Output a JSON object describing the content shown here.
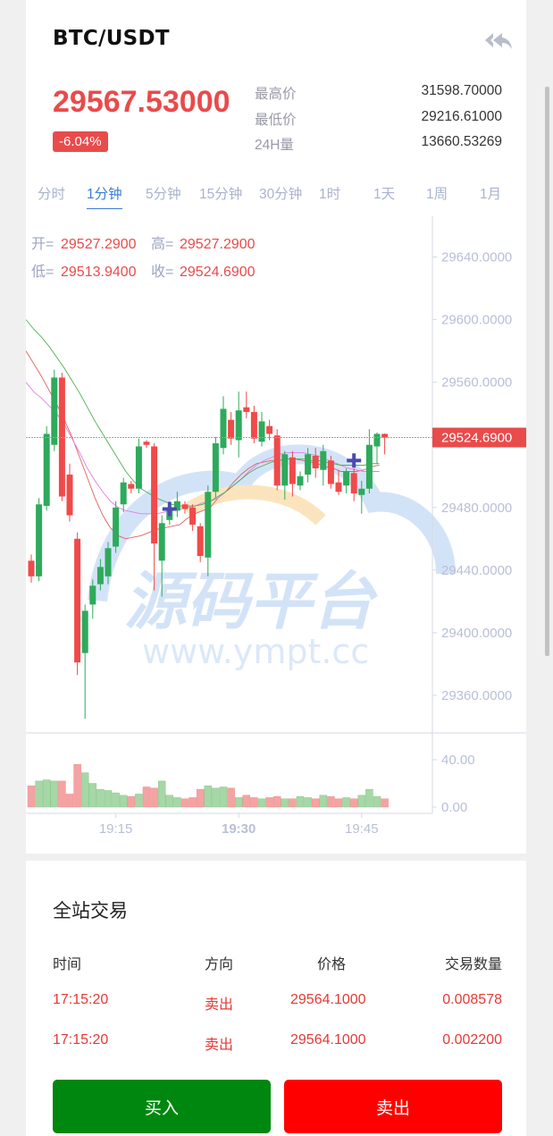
{
  "header": {
    "pair": "BTC/USDT",
    "back_icon": "double-back-arrow-icon"
  },
  "ticker": {
    "price": "29567.53000",
    "change": "-6.04%",
    "stats": [
      {
        "label": "最高价",
        "value": "31598.70000"
      },
      {
        "label": "最低价",
        "value": "29216.61000"
      },
      {
        "label": "24H量",
        "value": "13660.53269"
      }
    ]
  },
  "tabs": [
    {
      "label": "分时",
      "active": false
    },
    {
      "label": "1分钟",
      "active": true
    },
    {
      "label": "5分钟",
      "active": false
    },
    {
      "label": "15分钟",
      "active": false
    },
    {
      "label": "30分钟",
      "active": false
    },
    {
      "label": "1时",
      "active": false
    },
    {
      "label": "1天",
      "active": false
    },
    {
      "label": "1周",
      "active": false
    },
    {
      "label": "1月",
      "active": false
    }
  ],
  "watermark": {
    "cn": "源码平台",
    "url": "www.ympt.cc"
  },
  "chart_data": {
    "type": "candlestick",
    "ohlc_legend": {
      "open_label": "开=",
      "open": "29527.2900",
      "high_label": "高=",
      "high": "29527.2900",
      "low_label": "低=",
      "low": "29513.9400",
      "close_label": "收=",
      "close": "29524.6900"
    },
    "y_ticks": [
      "29640.0000",
      "29600.0000",
      "29560.0000",
      "29480.0000",
      "29440.0000",
      "29400.0000",
      "29360.0000"
    ],
    "ylim": [
      29336,
      29666
    ],
    "last_price_label": "29524.6900",
    "last_price": 29524.69,
    "volume_ticks": [
      "40.00",
      "0.00"
    ],
    "volume_max": 40,
    "x_ticks": [
      "19:15",
      "19:30",
      "19:45"
    ],
    "colors": {
      "up": "#2eaa5c",
      "down": "#f04a4a",
      "up_vol": "#a6d7a6",
      "down_vol": "#f4a3a3"
    },
    "candles": [
      {
        "o": 29446,
        "c": 29436,
        "h": 29450,
        "l": 29432
      },
      {
        "o": 29436,
        "c": 29482,
        "h": 29486,
        "l": 29433
      },
      {
        "o": 29481,
        "c": 29527,
        "h": 29532,
        "l": 29478
      },
      {
        "o": 29520,
        "c": 29563,
        "h": 29568,
        "l": 29516
      },
      {
        "o": 29563,
        "c": 29487,
        "h": 29566,
        "l": 29484
      },
      {
        "o": 29501,
        "c": 29475,
        "h": 29508,
        "l": 29471
      },
      {
        "o": 29460,
        "c": 29381,
        "h": 29464,
        "l": 29373
      },
      {
        "o": 29387,
        "c": 29414,
        "h": 29418,
        "l": 29345
      },
      {
        "o": 29418,
        "c": 29430,
        "h": 29434,
        "l": 29409
      },
      {
        "o": 29431,
        "c": 29442,
        "h": 29447,
        "l": 29427
      },
      {
        "o": 29436,
        "c": 29454,
        "h": 29458,
        "l": 29431
      },
      {
        "o": 29455,
        "c": 29480,
        "h": 29484,
        "l": 29451
      },
      {
        "o": 29482,
        "c": 29496,
        "h": 29499,
        "l": 29477
      },
      {
        "o": 29495,
        "c": 29492,
        "h": 29497,
        "l": 29489
      },
      {
        "o": 29492,
        "c": 29519,
        "h": 29524,
        "l": 29489
      },
      {
        "o": 29522,
        "c": 29520,
        "h": 29523,
        "l": 29518
      },
      {
        "o": 29519,
        "c": 29457,
        "h": 29521,
        "l": 29427
      },
      {
        "o": 29446,
        "c": 29470,
        "h": 29475,
        "l": 29423
      },
      {
        "o": 29472,
        "c": 29479,
        "h": 29484,
        "l": 29469
      },
      {
        "o": 29478,
        "c": 29484,
        "h": 29490,
        "l": 29474
      },
      {
        "o": 29482,
        "c": 29479,
        "h": 29484,
        "l": 29476
      },
      {
        "o": 29480,
        "c": 29469,
        "h": 29482,
        "l": 29465
      },
      {
        "o": 29468,
        "c": 29449,
        "h": 29470,
        "l": 29445
      },
      {
        "o": 29448,
        "c": 29490,
        "h": 29494,
        "l": 29436
      },
      {
        "o": 29490,
        "c": 29521,
        "h": 29525,
        "l": 29486
      },
      {
        "o": 29518,
        "c": 29543,
        "h": 29551,
        "l": 29514
      },
      {
        "o": 29536,
        "c": 29524,
        "h": 29541,
        "l": 29520
      },
      {
        "o": 29523,
        "c": 29542,
        "h": 29554,
        "l": 29512
      },
      {
        "o": 29544,
        "c": 29541,
        "h": 29554,
        "l": 29537
      },
      {
        "o": 29541,
        "c": 29524,
        "h": 29545,
        "l": 29521
      },
      {
        "o": 29522,
        "c": 29535,
        "h": 29541,
        "l": 29519
      },
      {
        "o": 29532,
        "c": 29527,
        "h": 29536,
        "l": 29523
      },
      {
        "o": 29526,
        "c": 29494,
        "h": 29530,
        "l": 29491
      },
      {
        "o": 29494,
        "c": 29514,
        "h": 29516,
        "l": 29485
      },
      {
        "o": 29512,
        "c": 29495,
        "h": 29516,
        "l": 29487
      },
      {
        "o": 29494,
        "c": 29500,
        "h": 29503,
        "l": 29491
      },
      {
        "o": 29501,
        "c": 29514,
        "h": 29518,
        "l": 29496
      },
      {
        "o": 29513,
        "c": 29505,
        "h": 29518,
        "l": 29499
      },
      {
        "o": 29504,
        "c": 29516,
        "h": 29520,
        "l": 29494
      },
      {
        "o": 29510,
        "c": 29495,
        "h": 29513,
        "l": 29492
      },
      {
        "o": 29496,
        "c": 29490,
        "h": 29504,
        "l": 29488
      },
      {
        "o": 29494,
        "c": 29503,
        "h": 29505,
        "l": 29489
      },
      {
        "o": 29502,
        "c": 29489,
        "h": 29505,
        "l": 29484
      },
      {
        "o": 29488,
        "c": 29492,
        "h": 29497,
        "l": 29476
      },
      {
        "o": 29492,
        "c": 29520,
        "h": 29530,
        "l": 29489
      },
      {
        "o": 29519,
        "c": 29527,
        "h": 29528,
        "l": 29508
      },
      {
        "o": 29527,
        "c": 29524.69,
        "h": 29527.29,
        "l": 29513.94
      }
    ],
    "volumes": [
      18,
      22,
      23,
      22,
      22,
      11,
      36,
      29,
      20,
      15,
      14,
      12,
      10,
      9,
      11,
      17,
      16,
      22,
      10,
      8,
      7,
      8,
      15,
      18,
      16,
      17,
      16,
      8,
      10,
      8,
      7,
      8,
      9,
      7,
      7,
      9,
      8,
      7,
      10,
      9,
      7,
      8,
      7,
      10,
      15,
      9,
      7
    ],
    "ma_lines": [
      {
        "color": "#e05f5f",
        "values": [
          29580,
          29572,
          29564,
          29555,
          29546,
          29536,
          29525,
          29512,
          29499,
          29486,
          29475,
          29467,
          29462,
          29460,
          29461,
          29462,
          29464,
          29466,
          29467,
          29468,
          29469,
          29473,
          29476,
          29478,
          29480,
          29486,
          29490,
          29496,
          29501,
          29505,
          29508,
          29509,
          29510,
          29510,
          29511,
          29511,
          29510,
          29509,
          29508,
          29506,
          29505,
          29503,
          29503,
          29503,
          29504,
          29506,
          29507
        ]
      },
      {
        "color": "#e27de7",
        "values": [
          29560,
          29554,
          29550,
          29545,
          29540,
          29533,
          29524,
          29515,
          29505,
          29497,
          29490,
          29484,
          29480,
          29478,
          29477,
          29476,
          29476,
          29476,
          29477,
          29478,
          29479,
          29480,
          29481,
          29483,
          29484,
          29486,
          29490,
          29494,
          29498,
          29503,
          29507,
          29510,
          29512,
          29514,
          29515,
          29515,
          29515,
          29514,
          29513,
          29511,
          29509,
          29507,
          29505,
          29504,
          29503,
          29503,
          29503
        ]
      },
      {
        "color": "#4caf50",
        "values": [
          29600,
          29594,
          29589,
          29583,
          29576,
          29569,
          29561,
          29553,
          29544,
          29535,
          29527,
          29519,
          29511,
          29503,
          29497,
          29492,
          29489,
          29486,
          29484,
          29482,
          29481,
          29481,
          29481,
          29482,
          29484,
          29487,
          29490,
          29494,
          29498,
          29502,
          29505,
          29507,
          29509,
          29510,
          29511,
          29511,
          29511,
          29510,
          29510,
          29509,
          29508,
          29507,
          29507,
          29507,
          29507,
          29508,
          29508
        ]
      }
    ],
    "markers": [
      {
        "index": 18,
        "value": 29479,
        "color": "#4a4ab0"
      },
      {
        "index": 42,
        "value": 29510,
        "color": "#4a4ab0"
      }
    ]
  },
  "trades": {
    "title": "全站交易",
    "headers": [
      "时间",
      "方向",
      "价格",
      "交易数量"
    ],
    "rows": [
      [
        "17:15:20",
        "卖出",
        "29564.1000",
        "0.008578"
      ],
      [
        "17:15:20",
        "卖出",
        "29564.1000",
        "0.002200"
      ]
    ],
    "buy_label": "买入",
    "sell_label": "卖出"
  }
}
